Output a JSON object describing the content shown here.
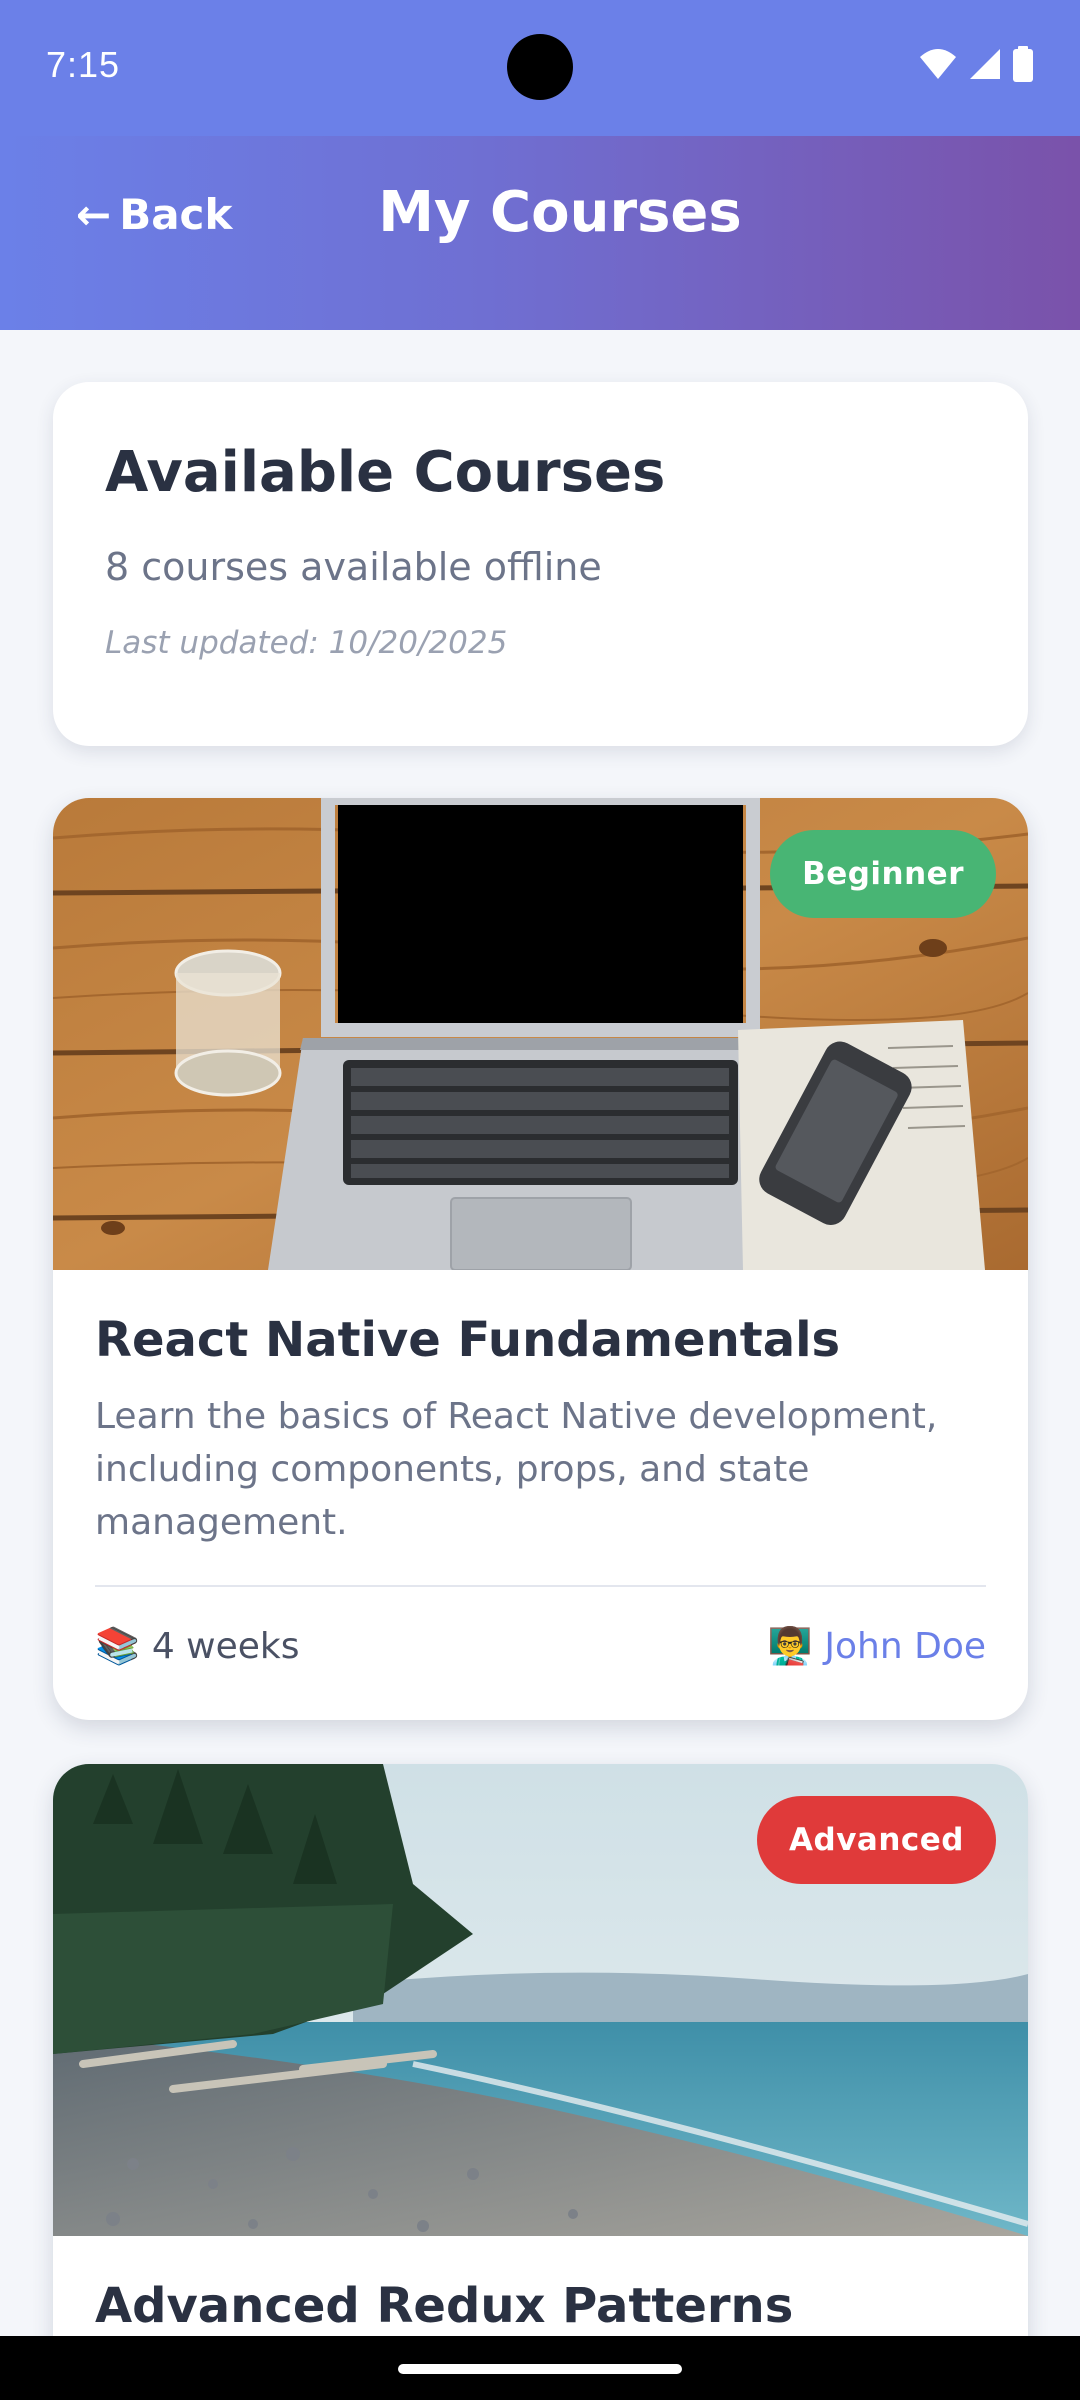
{
  "status_bar": {
    "time": "7:15",
    "icons": [
      "wifi-icon",
      "signal-icon",
      "battery-icon"
    ]
  },
  "header": {
    "back_arrow": "←",
    "back_label": "Back",
    "title": "My Courses"
  },
  "summary": {
    "title": "Available Courses",
    "count_text": "8 courses available offline",
    "updated_text": "Last updated: 10/20/2025"
  },
  "courses": [
    {
      "title": "React Native Fundamentals",
      "description": "Learn the basics of React Native development, including components, props, and state management.",
      "level": "Beginner",
      "level_color": "#48b574",
      "duration_icon": "📚",
      "duration": "4 weeks",
      "instructor_icon": "👨‍🏫",
      "instructor": "John Doe",
      "image": "laptop-on-wooden-desk-photo"
    },
    {
      "title": "Advanced Redux Patterns",
      "level": "Advanced",
      "level_color": "#e03a3a",
      "image": "rocky-beach-shoreline-photo"
    }
  ],
  "colors": {
    "accent": "#6b80e8",
    "header_gradient_end": "#7a52aa",
    "background": "#f4f6fa"
  }
}
